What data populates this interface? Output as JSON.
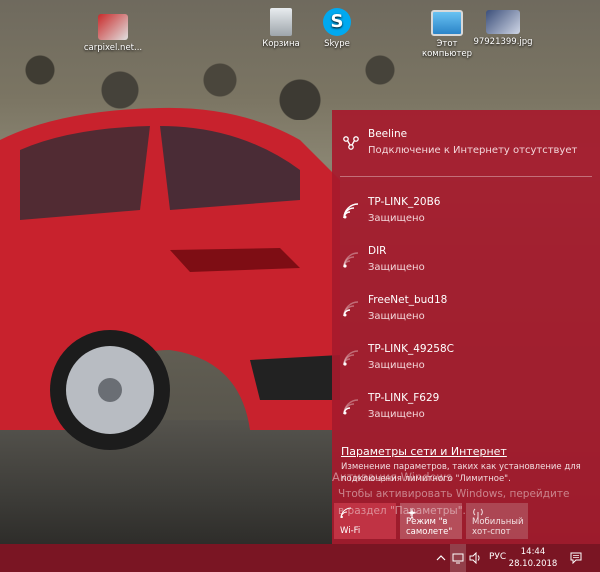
{
  "desktop": {
    "icons": [
      {
        "label": "carpixel.net..."
      },
      {
        "label": "Корзина"
      },
      {
        "label": "Skype"
      },
      {
        "label": "Этот\nкомпьютер"
      },
      {
        "label": "97921399.jpg"
      }
    ]
  },
  "flyout": {
    "connected": {
      "name": "Beeline",
      "status": "Подключение к Интернету отсутствует"
    },
    "networks": [
      {
        "name": "TP-LINK_20B6",
        "status": "Защищено"
      },
      {
        "name": "DIR",
        "status": "Защищено"
      },
      {
        "name": "FreeNet_bud18",
        "status": "Защищено"
      },
      {
        "name": "TP-LINK_49258C",
        "status": "Защищено"
      },
      {
        "name": "TP-LINK_F629",
        "status": "Защищено"
      }
    ],
    "settings_link": "Параметры сети и Интернет",
    "settings_desc": "Изменение параметров, таких как установление для подключения лимитного \"Лимитное\".",
    "watermark_line1": "Активация Windows",
    "watermark_line2": "Чтобы активировать Windows, перейдите в раздел \"Параметры\".",
    "quick_actions": {
      "wifi": "Wi-Fi",
      "airplane": "Режим \"в самолете\"",
      "hotspot": "Мобильный хот-спот"
    }
  },
  "taskbar": {
    "language": "РУС",
    "time": "14:44",
    "date": "28.10.2018"
  },
  "colors": {
    "flyout_bg": "#a61a2c",
    "taskbar_bg": "#7a1523",
    "wifi_tile": "#c03344"
  }
}
